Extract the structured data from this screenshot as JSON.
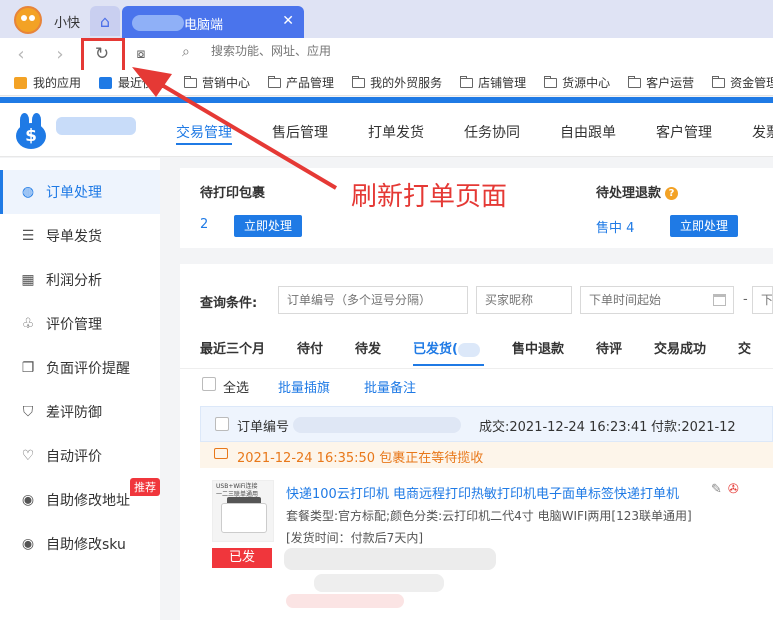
{
  "browser": {
    "app_name": "小快",
    "active_tab_label": "电脑端",
    "address_placeholder": "搜索功能、网址、应用",
    "bookmarks": [
      "我的应用",
      "最近使用",
      "营销中心",
      "产品管理",
      "我的外贸服务",
      "店铺管理",
      "货源中心",
      "客户运营",
      "资金管理"
    ]
  },
  "topnav": [
    "交易管理",
    "售后管理",
    "打单发货",
    "任务协同",
    "自由跟单",
    "客户管理",
    "发票"
  ],
  "sidebar": [
    {
      "label": "订单处理",
      "icon": "order-icon"
    },
    {
      "label": "导单发货",
      "icon": "import-icon"
    },
    {
      "label": "利润分析",
      "icon": "chart-icon"
    },
    {
      "label": "评价管理",
      "icon": "review-icon"
    },
    {
      "label": "负面评价提醒",
      "icon": "alert-icon"
    },
    {
      "label": "差评防御",
      "icon": "shield-icon"
    },
    {
      "label": "自动评价",
      "icon": "heart-icon"
    },
    {
      "label": "自助修改地址",
      "icon": "location-icon"
    },
    {
      "label": "自助修改sku",
      "icon": "location-icon"
    }
  ],
  "badge_recommend": "推荐",
  "summary": {
    "print_label": "待打印包裹",
    "print_count": "2",
    "refund_label": "待处理退款",
    "refund_count": "售中 4",
    "action_label": "立即处理"
  },
  "annotation": "刷新打单页面",
  "query": {
    "label": "查询条件:",
    "order_placeholder": "订单编号（多个逗号分隔）",
    "buyer_placeholder": "买家昵称",
    "time_placeholder": "下单时间起始",
    "dash": "-",
    "end_placeholder": "下"
  },
  "status_tabs": [
    "最近三个月",
    "待付",
    "待发",
    "已发货(",
    "售中退款",
    "待评",
    "交易成功",
    "交"
  ],
  "select_all": "全选",
  "batch_flag": "批量插旗",
  "batch_note": "批量备注",
  "order": {
    "number_label": "订单编号",
    "deal_time": "成交:2021-12-24 16:23:41",
    "pay_time": "付款:2021-12",
    "package_status": "2021-12-24 16:35:50 包裹正在等待揽收",
    "product_title": "快递100云打印机 电商远程打印热敏打印机电子面单标签快递打单机",
    "sku": "套餐类型:官方标配;颜色分类:云打印机二代4寸 电脑WIFI两用[123联单通用]",
    "ship_time": "[发货时间：付款后7天内]",
    "status_tag": "已发",
    "image_caption_1": "USB+WiFi连接",
    "image_caption_2": "一二三联单通用"
  },
  "colors": {
    "accent": "#1f7ae5",
    "annotation": "#e53935",
    "warning": "#e8781a"
  }
}
